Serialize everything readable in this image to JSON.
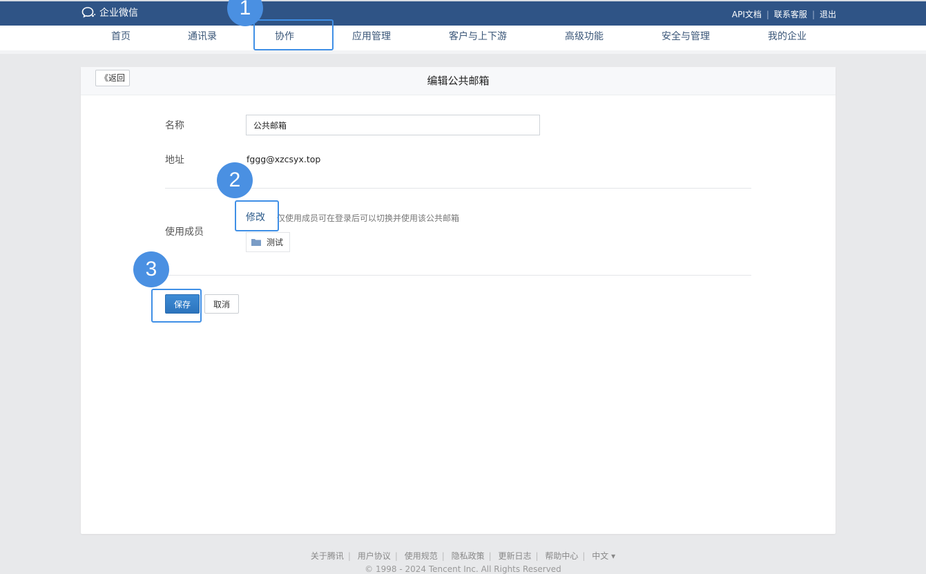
{
  "topbar": {
    "logo_text": "企业微信",
    "links": [
      "API文档",
      "联系客服",
      "退出"
    ]
  },
  "nav": {
    "items": [
      "首页",
      "通讯录",
      "协作",
      "应用管理",
      "客户与上下游",
      "高级功能",
      "安全与管理",
      "我的企业"
    ]
  },
  "page": {
    "back_label": "《返回",
    "title": "编辑公共邮箱",
    "name_label": "名称",
    "name_value": "公共邮箱",
    "address_label": "地址",
    "address_value": "fggg@xzcsyx.top",
    "members_label": "使用成员",
    "modify_label": "修改",
    "members_hint": "仅使用成员可在登录后可以切换并使用该公共邮箱",
    "member_tag": "测试",
    "save_label": "保存",
    "cancel_label": "取消"
  },
  "steps": [
    "1",
    "2",
    "3"
  ],
  "footer": {
    "links": [
      "关于腾讯",
      "用户协议",
      "使用规范",
      "隐私政策",
      "更新日志",
      "帮助中心"
    ],
    "language": "中文 ▾",
    "copyright": "© 1998 - 2024 Tencent Inc. All Rights Reserved"
  },
  "colors": {
    "topbar": "#2f5486",
    "accent": "#3f8fe6",
    "primary_button": "#2c74bd"
  }
}
